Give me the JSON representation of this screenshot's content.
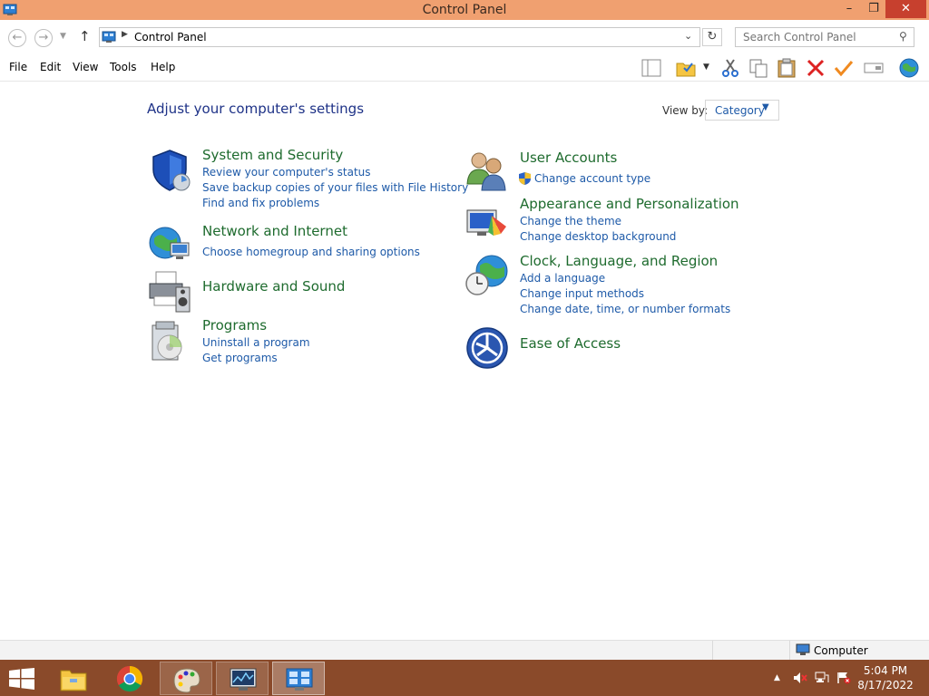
{
  "window": {
    "title": "Control Panel"
  },
  "address": {
    "path": "Control Panel",
    "search_placeholder": "Search Control Panel"
  },
  "menu": [
    "File",
    "Edit",
    "View",
    "Tools",
    "Help"
  ],
  "content": {
    "heading": "Adjust your computer's settings",
    "view_by_label": "View by:",
    "view_by_value": "Category",
    "left": [
      {
        "title": "System and Security",
        "links": [
          "Review your computer's status",
          "Save backup copies of your files with File History",
          "Find and fix problems"
        ]
      },
      {
        "title": "Network and Internet",
        "links": [
          "Choose homegroup and sharing options"
        ]
      },
      {
        "title": "Hardware and Sound",
        "links": []
      },
      {
        "title": "Programs",
        "links": [
          "Uninstall a program",
          "Get programs"
        ]
      }
    ],
    "right": [
      {
        "title": "User Accounts",
        "links": [
          "Change account type"
        ]
      },
      {
        "title": "Appearance and Personalization",
        "links": [
          "Change the theme",
          "Change desktop background"
        ]
      },
      {
        "title": "Clock, Language, and Region",
        "links": [
          "Add a language",
          "Change input methods",
          "Change date, time, or number formats"
        ]
      },
      {
        "title": "Ease of Access",
        "links": []
      }
    ]
  },
  "status": {
    "location": "Computer"
  },
  "taskbar": {
    "time": "5:04 PM",
    "date": "8/17/2022"
  },
  "colors": {
    "titlebar": "#f0a070",
    "taskbar": "#8a4a2a",
    "link": "#1e5aa8",
    "category_title": "#1e6b2e",
    "heading": "#1e3287"
  }
}
